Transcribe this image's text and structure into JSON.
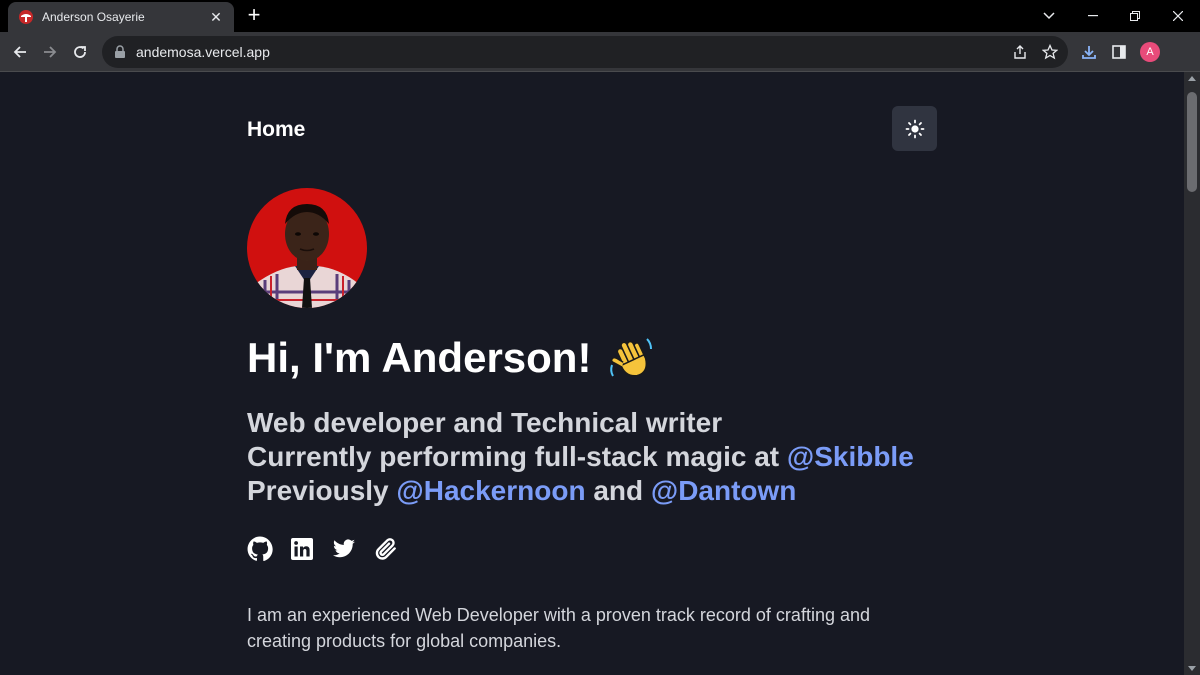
{
  "browser": {
    "tab_title": "Anderson Osayerie",
    "url": "andemosa.vercel.app",
    "profile_initial": "A"
  },
  "nav": {
    "home_label": "Home",
    "theme_icon": "sun-icon"
  },
  "hero": {
    "greeting": "Hi, I'm Anderson!",
    "greeting_emoji": "👋",
    "role": "Web developer and Technical writer",
    "current_prefix": "Currently performing full-stack magic at",
    "current_company": "@Skibble",
    "previous_prefix": "Previously",
    "previous_company_1": "@Hackernoon",
    "previous_connector": "and",
    "previous_company_2": "@Dantown"
  },
  "socials": [
    "github-icon",
    "linkedin-icon",
    "twitter-icon",
    "paperclip-icon"
  ],
  "bio": "I am an experienced Web Developer with a proven track record of crafting and creating products for global companies.",
  "colors": {
    "page_bg": "#171923",
    "link": "#7b9cf7",
    "heading": "#ffffff",
    "body_text": "#d4d6dc",
    "theme_button_bg": "#303440"
  }
}
